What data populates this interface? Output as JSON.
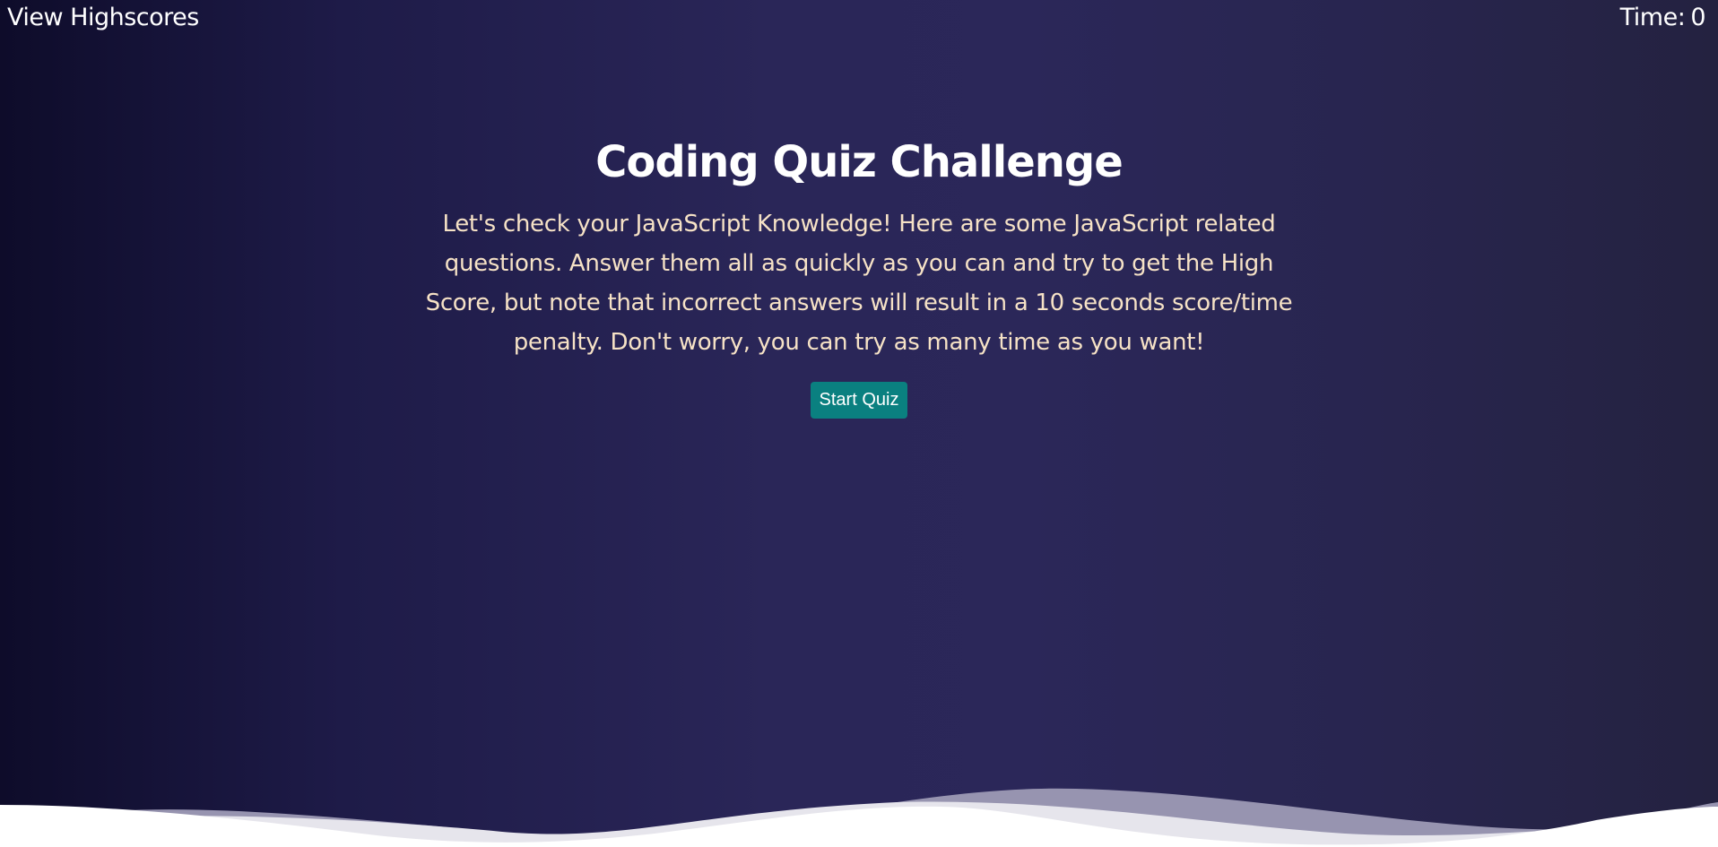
{
  "header": {
    "highscores_label": "View Highscores",
    "timer_label": "Time:",
    "timer_value": "0"
  },
  "main": {
    "title": "Coding Quiz Challenge",
    "intro": "Let's check your JavaScript Knowledge! Here are some JavaScript related questions. Answer them all as quickly as you can and try to get the High Score, but note that incorrect answers will result in a 10 seconds score/time penalty. Don't worry, you can try as many time as you want!",
    "start_button_label": "Start Quiz"
  },
  "colors": {
    "background_dark": "#0e0c2a",
    "background_mid": "#2b2759",
    "intro_text": "#f6e2c6",
    "button": "#0a8080",
    "wave_back": "#9794b0",
    "wave_mid": "#e6e5ec",
    "wave_front": "#ffffff"
  }
}
